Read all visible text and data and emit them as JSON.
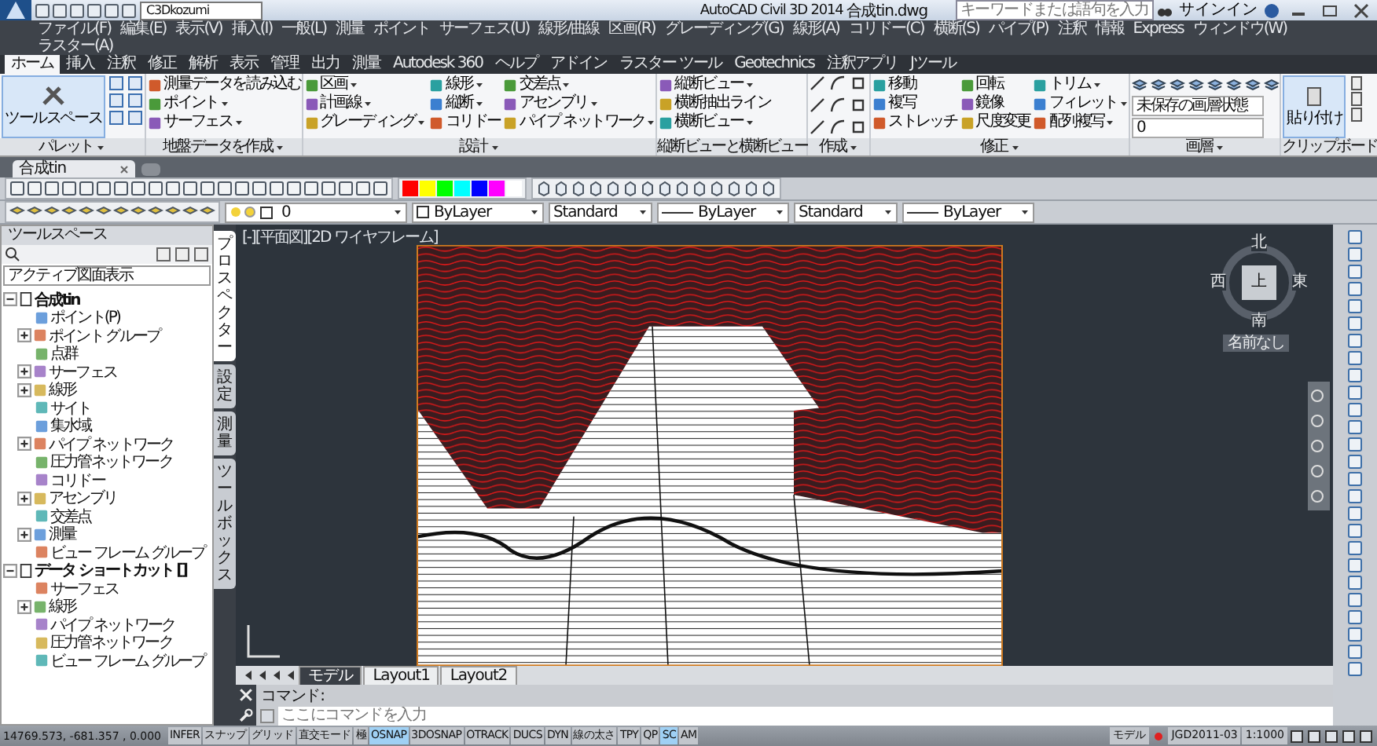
{
  "window": {
    "title": "AutoCAD Civil 3D 2014",
    "file": "合成tin.dwg",
    "workspace": "C3Dkozumi",
    "search_placeholder": "キーワードまたは語句を入力",
    "sign_in": "サインイン"
  },
  "menu": [
    "ファイル(F)",
    "編集(E)",
    "表示(V)",
    "挿入(I)",
    "一般(L)",
    "測量",
    "ポイント",
    "サーフェス(U)",
    "線形/曲線",
    "区画(R)",
    "グレーディング(G)",
    "線形(A)",
    "コリドー(C)",
    "横断(S)",
    "パイプ(P)",
    "注釈",
    "情報",
    "Express",
    "ウィンドウ(W)",
    "ラスター(A)"
  ],
  "ribbon": {
    "tabs": [
      {
        "label": "ホーム",
        "selected": true
      },
      {
        "label": "挿入",
        "selected": false
      },
      {
        "label": "注釈",
        "selected": false
      },
      {
        "label": "修正",
        "selected": false
      },
      {
        "label": "解析",
        "selected": false
      },
      {
        "label": "表示",
        "selected": false
      },
      {
        "label": "管理",
        "selected": false
      },
      {
        "label": "出力",
        "selected": false
      },
      {
        "label": "測量",
        "selected": false
      },
      {
        "label": "Autodesk 360",
        "selected": false
      },
      {
        "label": "ヘルプ",
        "selected": false
      },
      {
        "label": "アドイン",
        "selected": false
      },
      {
        "label": "ラスター ツール",
        "selected": false
      },
      {
        "label": "Geotechnics",
        "selected": false
      },
      {
        "label": "注釈アプリ",
        "selected": false
      },
      {
        "label": "Jツール",
        "selected": false
      }
    ],
    "panels": [
      {
        "kind": "palette",
        "title": "パレット",
        "title_menu": true,
        "big_button": "ツールスペース"
      },
      {
        "kind": "buttons",
        "title": "地盤データを作成",
        "title_menu": true,
        "columns": [
          [
            {
              "label": "測量データを読み込む",
              "dropdown": false
            },
            {
              "label": "ポイント",
              "dropdown": true
            },
            {
              "label": "サーフェス",
              "dropdown": true
            }
          ]
        ]
      },
      {
        "kind": "buttons",
        "title": "設計",
        "title_menu": true,
        "columns": [
          [
            {
              "label": "区画",
              "dropdown": true
            },
            {
              "label": "計画線",
              "dropdown": true
            },
            {
              "label": "グレーディング",
              "dropdown": true
            }
          ],
          [
            {
              "label": "線形",
              "dropdown": true
            },
            {
              "label": "縦断",
              "dropdown": true
            },
            {
              "label": "コリドー",
              "dropdown": false
            }
          ],
          [
            {
              "label": "交差点",
              "dropdown": true
            },
            {
              "label": "アセンブリ",
              "dropdown": true
            },
            {
              "label": "パイプ ネットワーク",
              "dropdown": true
            }
          ]
        ]
      },
      {
        "kind": "buttons",
        "title": "縦断ビューと横断ビュー",
        "title_menu": false,
        "columns": [
          [
            {
              "label": "縦断ビュー",
              "dropdown": true
            },
            {
              "label": "横断抽出ライン",
              "dropdown": false
            },
            {
              "label": "横断ビュー",
              "dropdown": true
            }
          ]
        ]
      },
      {
        "kind": "icons",
        "title": "作成",
        "title_menu": true
      },
      {
        "kind": "buttons",
        "title": "修正",
        "title_menu": true,
        "columns": [
          [
            {
              "label": "移動",
              "dropdown": false
            },
            {
              "label": "複写",
              "dropdown": false
            },
            {
              "label": "ストレッチ",
              "dropdown": false
            }
          ],
          [
            {
              "label": "回転",
              "dropdown": false
            },
            {
              "label": "鏡像",
              "dropdown": false
            },
            {
              "label": "尺度変更",
              "dropdown": false
            }
          ],
          [
            {
              "label": "トリム",
              "dropdown": true
            },
            {
              "label": "フィレット",
              "dropdown": true
            },
            {
              "label": "配列複写",
              "dropdown": true
            }
          ]
        ]
      },
      {
        "kind": "layers",
        "title": "画層",
        "title_menu": true,
        "layer_state": "未保存の画層状態",
        "layer": "0"
      },
      {
        "kind": "clipboard",
        "title": "クリップボード",
        "title_menu": false,
        "paste": "貼り付け"
      }
    ]
  },
  "document_tab": "合成tin",
  "toolbar": {
    "color_swatches": [
      {
        "color": "#ff0000"
      },
      {
        "color": "#ffff00"
      },
      {
        "color": "#00ff00"
      },
      {
        "color": "#00ffff"
      },
      {
        "color": "#0000ff"
      },
      {
        "color": "#ff00ff"
      },
      {
        "color": "#ffffff"
      }
    ],
    "dropdowns": [
      {
        "kind": "layer",
        "value": "0"
      },
      {
        "kind": "color",
        "value": "ByLayer"
      },
      {
        "kind": "plain",
        "value": "Standard"
      },
      {
        "kind": "line",
        "value": "ByLayer"
      },
      {
        "kind": "plain",
        "value": "Standard"
      },
      {
        "kind": "line",
        "value": "ByLayer"
      }
    ]
  },
  "toolspace": {
    "title": "ツールスペース",
    "view": "アクティブ図面表示",
    "tree": [
      {
        "label": "合成tin",
        "expanded": true,
        "children": [
          {
            "label": "ポイント(P)",
            "kind": "leaf",
            "expanded": false
          },
          {
            "label": "ポイント グループ",
            "kind": "branch",
            "expanded": false
          },
          {
            "label": "点群",
            "kind": "leaf",
            "expanded": false
          },
          {
            "label": "サーフェス",
            "kind": "branch",
            "expanded": false
          },
          {
            "label": "線形",
            "kind": "branch",
            "expanded": false
          },
          {
            "label": "サイト",
            "kind": "leaf",
            "expanded": false
          },
          {
            "label": "集水域",
            "kind": "leaf",
            "expanded": false
          },
          {
            "label": "パイプ ネットワーク",
            "kind": "branch",
            "expanded": false
          },
          {
            "label": "圧力管ネットワーク",
            "kind": "leaf",
            "expanded": false
          },
          {
            "label": "コリドー",
            "kind": "leaf",
            "expanded": false
          },
          {
            "label": "アセンブリ",
            "kind": "branch",
            "expanded": false
          },
          {
            "label": "交差点",
            "kind": "leaf",
            "expanded": false
          },
          {
            "label": "測量",
            "kind": "branch",
            "expanded": false
          },
          {
            "label": "ビュー フレーム グループ",
            "kind": "leaf",
            "expanded": false
          }
        ]
      },
      {
        "label": "データ ショートカット []",
        "expanded": true,
        "children": [
          {
            "label": "サーフェス",
            "kind": "leaf",
            "expanded": false
          },
          {
            "label": "線形",
            "kind": "branch",
            "expanded": false
          },
          {
            "label": "パイプ ネットワーク",
            "kind": "leaf",
            "expanded": false
          },
          {
            "label": "圧力管ネットワーク",
            "kind": "leaf",
            "expanded": false
          },
          {
            "label": "ビュー フレーム グループ",
            "kind": "leaf",
            "expanded": false
          }
        ]
      }
    ],
    "side_tabs": [
      {
        "label": "プロスペクター",
        "selected": true
      },
      {
        "label": "設定",
        "selected": false
      },
      {
        "label": "測量",
        "selected": false
      },
      {
        "label": "ツールボックス",
        "selected": false
      }
    ]
  },
  "viewport": {
    "label": "[-][平面図][2D ワイヤフレーム]",
    "compass": {
      "north": "北",
      "south": "南",
      "east": "東",
      "west": "西",
      "top": "上",
      "ucs": "名前なし"
    }
  },
  "layout_tabs": [
    {
      "label": "モデル",
      "selected": true
    },
    {
      "label": "Layout1",
      "selected": false
    },
    {
      "label": "Layout2",
      "selected": false
    }
  ],
  "command": {
    "history": "コマンド:",
    "placeholder": "ここにコマンドを入力"
  },
  "status_bar": {
    "coordinates": "14769.573, -681.357 , 0.000",
    "toggles": [
      {
        "label": "INFER",
        "on": false
      },
      {
        "label": "スナップ",
        "on": false
      },
      {
        "label": "グリッド",
        "on": false
      },
      {
        "label": "直交モード",
        "on": false
      },
      {
        "label": "極",
        "on": false
      },
      {
        "label": "OSNAP",
        "on": true
      },
      {
        "label": "3DOSNAP",
        "on": false
      },
      {
        "label": "OTRACK",
        "on": false
      },
      {
        "label": "DUCS",
        "on": false
      },
      {
        "label": "DYN",
        "on": false
      },
      {
        "label": "線の太さ",
        "on": false
      },
      {
        "label": "TPY",
        "on": false
      },
      {
        "label": "QP",
        "on": false
      },
      {
        "label": "SC",
        "on": true
      },
      {
        "label": "AM",
        "on": false
      }
    ],
    "model": "モデル",
    "coordinate_system": "JGD2011-03",
    "scale": "1:1000"
  }
}
